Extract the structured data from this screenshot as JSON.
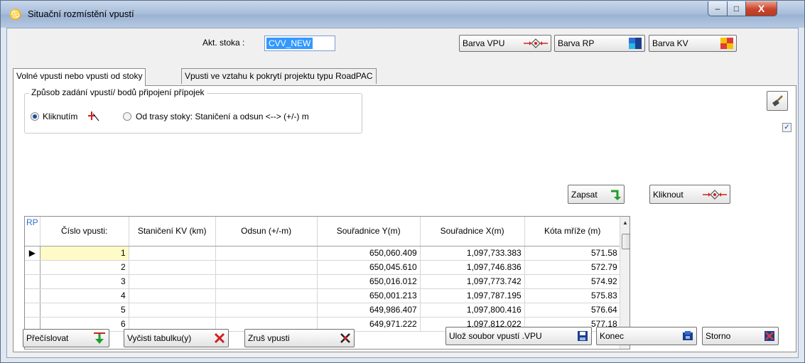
{
  "window": {
    "title": "Situační rozmístění vpustí",
    "min_label": "–",
    "max_label": "□",
    "close_label": "X"
  },
  "header": {
    "stoka_label": "Akt. stoka :",
    "stoka_value": "CVV_NEW",
    "btn_vpu": "Barva VPU",
    "btn_rp": "Barva RP",
    "btn_kv": "Barva KV"
  },
  "tabs": [
    {
      "label": "Volné vpusti nebo vpusti od stoky",
      "active": true
    },
    {
      "label": "Vpusti ve vztahu k pokrytí projektu typu RoadPAC",
      "active": false
    }
  ],
  "mode_group": {
    "title": "Způsob zadání vpustí/ bodů připojení přípojek",
    "option1": "Kliknutím",
    "option2": "Od trasy stoky: Staničení a odsun <--> (+/-) m",
    "selected": "Kliknutím"
  },
  "checkbox_mark": "✓",
  "actions": {
    "zapsat": "Zapsat",
    "kliknout": "Kliknout"
  },
  "table": {
    "columns": [
      "RP",
      "Číslo  vpusti:",
      "Staničení KV (km)",
      "Odsun (+/-m)",
      "Souřadnice Y(m)",
      "Souřadnice X(m)",
      "Kóta mříže (m)"
    ],
    "rows": [
      [
        "1",
        "",
        "",
        "650,060.409",
        "1,097,733.383",
        "571.58"
      ],
      [
        "2",
        "",
        "",
        "650,045.610",
        "1,097,746.836",
        "572.79"
      ],
      [
        "3",
        "",
        "",
        "650,016.012",
        "1,097,773.742",
        "574.92"
      ],
      [
        "4",
        "",
        "",
        "650,001.213",
        "1,097,787.195",
        "575.83"
      ],
      [
        "5",
        "",
        "",
        "649,986.407",
        "1,097,800.416",
        "576.64"
      ],
      [
        "6",
        "",
        "",
        "649,971.222",
        "1,097,812.022",
        "577.18"
      ]
    ],
    "current_row_marker": "▶"
  },
  "footer": {
    "precislovat": "Přečíslovat",
    "vycisti": "Vyčisti tabulku(y)",
    "zrus": "Zruš vpusti",
    "uloz": "Ulož  soubor vpustí .VPU",
    "konec": "Konec",
    "storno": "Storno"
  },
  "colors": {
    "accent_blue": "#2f6ed3",
    "green_arrow": "#1f9e2a",
    "red_x": "#d11f1f"
  }
}
